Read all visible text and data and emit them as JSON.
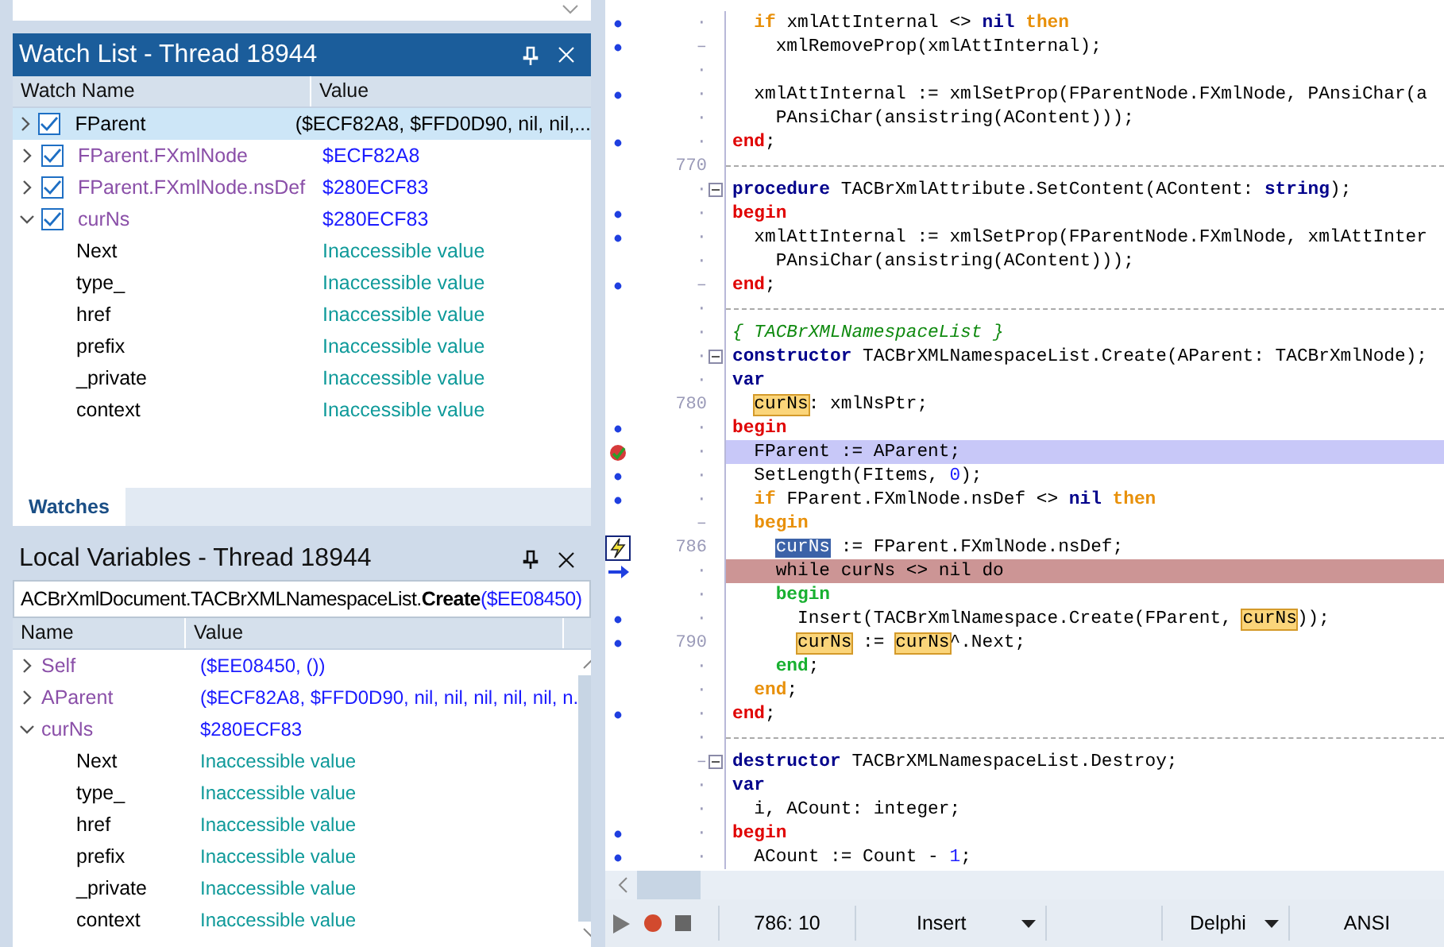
{
  "watch_list": {
    "title": "Watch List - Thread 18944",
    "columns": [
      "Watch Name",
      "Value"
    ],
    "items": [
      {
        "name": "FParent",
        "value": {
          "text": "($ECF82A8, $FFD0D90, nil, nil,...",
          "color": "#000000"
        },
        "checked": true,
        "expanded": false,
        "selected": true,
        "color": "#000000"
      },
      {
        "name": "FParent.FXmlNode",
        "value": {
          "text": "$ECF82A8",
          "color": "#1a1aff"
        },
        "checked": true,
        "expanded": false,
        "selected": false,
        "color": "#8a4fa8"
      },
      {
        "name": "FParent.FXmlNode.nsDef",
        "value": {
          "text": "$280ECF83",
          "color": "#1a1aff"
        },
        "checked": true,
        "expanded": false,
        "selected": false,
        "color": "#8a4fa8"
      },
      {
        "name": "curNs",
        "value": {
          "text": "$280ECF83",
          "color": "#1a1aff"
        },
        "checked": true,
        "expanded": true,
        "selected": false,
        "color": "#8a4fa8",
        "children": [
          {
            "name": "Next",
            "value": {
              "text": "Inaccessible value",
              "color": "#0f9a9a"
            },
            "color": "#000000"
          },
          {
            "name": "type_",
            "value": {
              "text": "Inaccessible value",
              "color": "#0f9a9a"
            },
            "color": "#000000"
          },
          {
            "name": "href",
            "value": {
              "text": "Inaccessible value",
              "color": "#0f9a9a"
            },
            "color": "#000000"
          },
          {
            "name": "prefix",
            "value": {
              "text": "Inaccessible value",
              "color": "#0f9a9a"
            },
            "color": "#000000"
          },
          {
            "name": "_private",
            "value": {
              "text": "Inaccessible value",
              "color": "#0f9a9a"
            },
            "color": "#000000"
          },
          {
            "name": "context",
            "value": {
              "text": "Inaccessible value",
              "color": "#0f9a9a"
            },
            "color": "#000000"
          }
        ]
      }
    ],
    "tabs": [
      {
        "label": "Watches",
        "selected": true
      }
    ]
  },
  "local_variables": {
    "title": "Local Variables - Thread 18944",
    "frame": [
      {
        "text": "ACBrXmlDocument.TACBrXMLNamespaceList.",
        "kind": "plain"
      },
      {
        "text": "Create",
        "kind": "bold"
      },
      {
        "text": "($EE08450)",
        "kind": "address"
      }
    ],
    "columns": [
      "Name",
      "Value"
    ],
    "items": [
      {
        "name": "Self",
        "value": {
          "text": "($EE08450, ())",
          "color": "#1a1aff"
        },
        "expanded": false,
        "color": "#8a4fa8"
      },
      {
        "name": "AParent",
        "value": {
          "text": "($ECF82A8, $FFD0D90, nil, nil, nil, nil, nil, n.",
          "color": "#1a1aff"
        },
        "expanded": false,
        "color": "#8a4fa8"
      },
      {
        "name": "curNs",
        "value": {
          "text": "$280ECF83",
          "color": "#1a1aff"
        },
        "expanded": true,
        "color": "#8a4fa8",
        "children": [
          {
            "name": "Next",
            "value": {
              "text": "Inaccessible value",
              "color": "#0f9a9a"
            },
            "color": "#000000"
          },
          {
            "name": "type_",
            "value": {
              "text": "Inaccessible value",
              "color": "#0f9a9a"
            },
            "color": "#000000"
          },
          {
            "name": "href",
            "value": {
              "text": "Inaccessible value",
              "color": "#0f9a9a"
            },
            "color": "#000000"
          },
          {
            "name": "prefix",
            "value": {
              "text": "Inaccessible value",
              "color": "#0f9a9a"
            },
            "color": "#000000"
          },
          {
            "name": "_private",
            "value": {
              "text": "Inaccessible value",
              "color": "#0f9a9a"
            },
            "color": "#000000"
          },
          {
            "name": "context",
            "value": {
              "text": "Inaccessible value",
              "color": "#0f9a9a"
            },
            "color": "#000000"
          }
        ]
      }
    ]
  },
  "editor": {
    "lines": [
      {
        "kind": "dot",
        "gutter": "·",
        "tokens": [
          {
            "t": "  if",
            "kind": "flow"
          },
          {
            "t": " xmlAttInternal <> ",
            "kind": "plain"
          },
          {
            "t": "nil",
            "kind": "keyword"
          },
          {
            "t": " then",
            "kind": "flow"
          }
        ]
      },
      {
        "kind": "dot",
        "gutter": "–",
        "tokens": [
          {
            "t": "    xmlRemoveProp(xmlAttInternal);",
            "kind": "plain"
          }
        ]
      },
      {
        "kind": "none",
        "gutter": "·"
      },
      {
        "kind": "dot",
        "gutter": "·",
        "tokens": [
          {
            "t": "  xmlAttInternal := xmlSetProp(FParentNode.FXmlNode, PAnsiChar(a",
            "kind": "plain"
          }
        ]
      },
      {
        "kind": "none",
        "gutter": "·",
        "tokens": [
          {
            "t": "    PAnsiChar(ansistring(AContent)));",
            "kind": "plain"
          }
        ]
      },
      {
        "kind": "dot",
        "gutter": "·",
        "tokens": [
          {
            "t": "end",
            "kind": "block"
          },
          {
            "t": ";",
            "kind": "plain"
          }
        ]
      },
      {
        "kind": "none",
        "gutter": "770",
        "separator": true
      },
      {
        "kind": "none",
        "gutter": "·",
        "fold": true,
        "tokens": [
          {
            "t": "procedure",
            "kind": "keyword"
          },
          {
            "t": " TACBrXmlAttribute.SetContent(AContent: ",
            "kind": "plain"
          },
          {
            "t": "string",
            "kind": "keyword"
          },
          {
            "t": ");",
            "kind": "plain"
          }
        ]
      },
      {
        "kind": "dot",
        "gutter": "·",
        "tokens": [
          {
            "t": "begin",
            "kind": "block"
          }
        ]
      },
      {
        "kind": "dot",
        "gutter": "·",
        "tokens": [
          {
            "t": "  xmlAttInternal := xmlSetProp(FParentNode.FXmlNode, xmlAttInter",
            "kind": "plain"
          }
        ]
      },
      {
        "kind": "none",
        "gutter": "·",
        "tokens": [
          {
            "t": "    PAnsiChar(ansistring(AContent)));",
            "kind": "plain"
          }
        ]
      },
      {
        "kind": "dot",
        "gutter": "–",
        "tokens": [
          {
            "t": "end",
            "kind": "block"
          },
          {
            "t": ";",
            "kind": "plain"
          }
        ]
      },
      {
        "kind": "none",
        "gutter": "·",
        "separator": true
      },
      {
        "kind": "none",
        "gutter": "·",
        "tokens": [
          {
            "t": "{ TACBrXMLNamespaceList }",
            "kind": "comment"
          }
        ]
      },
      {
        "kind": "none",
        "gutter": "·",
        "fold": true,
        "tokens": [
          {
            "t": "constructor",
            "kind": "keyword"
          },
          {
            "t": " TACBrXMLNamespaceList.Create(AParent: TACBrXmlNode);",
            "kind": "plain"
          }
        ]
      },
      {
        "kind": "none",
        "gutter": "·",
        "tokens": [
          {
            "t": "var",
            "kind": "keyword"
          }
        ]
      },
      {
        "kind": "none",
        "gutter": "780",
        "tokens": [
          {
            "t": "  curNs",
            "kind": "match"
          },
          {
            "t": ": xmlNsPtr;",
            "kind": "plain"
          }
        ]
      },
      {
        "kind": "dot",
        "gutter": "·",
        "tokens": [
          {
            "t": "begin",
            "kind": "block"
          }
        ]
      },
      {
        "kind": "breakpoint",
        "gutter": "·",
        "current_line": true,
        "tokens": [
          {
            "t": "  FParent := AParent;",
            "kind": "plain"
          }
        ]
      },
      {
        "kind": "dot",
        "gutter": "·",
        "tokens": [
          {
            "t": "  SetLength(FItems, ",
            "kind": "plain"
          },
          {
            "t": "0",
            "kind": "number"
          },
          {
            "t": ");",
            "kind": "plain"
          }
        ]
      },
      {
        "kind": "dot",
        "gutter": "·",
        "tokens": [
          {
            "t": "  if",
            "kind": "flow"
          },
          {
            "t": " FParent.FXmlNode.nsDef <> ",
            "kind": "plain"
          },
          {
            "t": "nil",
            "kind": "keyword"
          },
          {
            "t": " then",
            "kind": "flow"
          }
        ]
      },
      {
        "kind": "none",
        "gutter": "–",
        "tokens": [
          {
            "t": "  begin",
            "kind": "flow"
          }
        ]
      },
      {
        "kind": "lightning",
        "gutter": "786",
        "tokens": [
          {
            "t": "    curNs",
            "kind": "selection"
          },
          {
            "t": " := FParent.FXmlNode.nsDef;",
            "kind": "plain"
          }
        ]
      },
      {
        "kind": "arrow",
        "gutter": "·",
        "error_line": true,
        "tokens": [
          {
            "t": "    while curNs <> nil do",
            "kind": "plain"
          }
        ]
      },
      {
        "kind": "none",
        "gutter": "·",
        "tokens": [
          {
            "t": "    begin",
            "kind": "inner"
          }
        ]
      },
      {
        "kind": "dot",
        "gutter": "·",
        "tokens": [
          {
            "t": "      Insert(TACBrXmlNamespace.Create(FParent, ",
            "kind": "plain"
          },
          {
            "t": "curNs",
            "kind": "match"
          },
          {
            "t": "));",
            "kind": "plain"
          }
        ]
      },
      {
        "kind": "dot",
        "gutter": "790",
        "tokens": [
          {
            "t": "      curNs",
            "kind": "match"
          },
          {
            "t": " := ",
            "kind": "plain"
          },
          {
            "t": "curNs",
            "kind": "match"
          },
          {
            "t": "^.Next;",
            "kind": "plain"
          }
        ]
      },
      {
        "kind": "none",
        "gutter": "·",
        "tokens": [
          {
            "t": "    end",
            "kind": "inner"
          },
          {
            "t": ";",
            "kind": "plain"
          }
        ]
      },
      {
        "kind": "none",
        "gutter": "·",
        "tokens": [
          {
            "t": "  end",
            "kind": "flow"
          },
          {
            "t": ";",
            "kind": "plain"
          }
        ]
      },
      {
        "kind": "dot",
        "gutter": "·",
        "tokens": [
          {
            "t": "end",
            "kind": "block"
          },
          {
            "t": ";",
            "kind": "plain"
          }
        ]
      },
      {
        "kind": "none",
        "gutter": "·",
        "separator": true
      },
      {
        "kind": "none",
        "gutter": "–",
        "fold": true,
        "tokens": [
          {
            "t": "destructor",
            "kind": "keyword"
          },
          {
            "t": " TACBrXMLNamespaceList.Destroy;",
            "kind": "plain"
          }
        ]
      },
      {
        "kind": "none",
        "gutter": "·",
        "tokens": [
          {
            "t": "var",
            "kind": "keyword"
          }
        ]
      },
      {
        "kind": "none",
        "gutter": "·",
        "tokens": [
          {
            "t": "  i, ACount: integer;",
            "kind": "plain"
          }
        ]
      },
      {
        "kind": "dot",
        "gutter": "·",
        "tokens": [
          {
            "t": "begin",
            "kind": "block"
          }
        ]
      },
      {
        "kind": "dot",
        "gutter": "·",
        "tokens": [
          {
            "t": "  ACount := Count - ",
            "kind": "plain"
          },
          {
            "t": "1",
            "kind": "number"
          },
          {
            "t": ";",
            "kind": "plain"
          }
        ]
      }
    ]
  },
  "status_bar": {
    "position": "786: 10",
    "mode": "Insert",
    "language": "Delphi",
    "encoding": "ANSI"
  }
}
